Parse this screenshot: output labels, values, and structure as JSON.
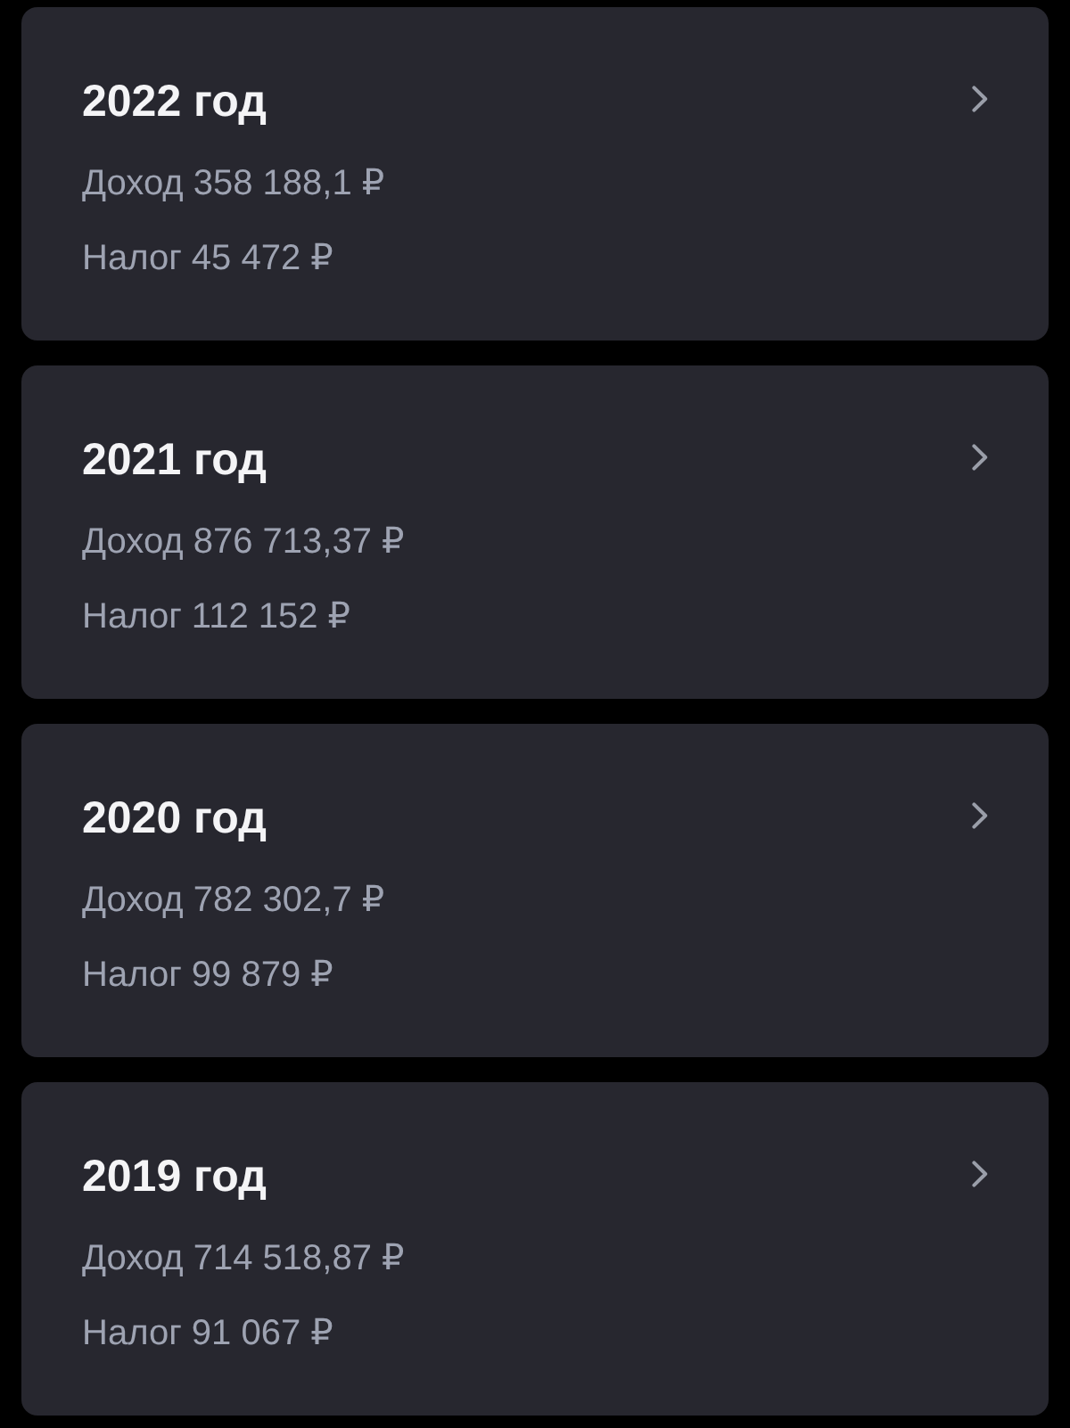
{
  "years": [
    {
      "title": "2022 год",
      "income": "Доход 358 188,1 ₽",
      "tax": "Налог 45 472 ₽"
    },
    {
      "title": "2021 год",
      "income": "Доход 876 713,37 ₽",
      "tax": "Налог 112 152 ₽"
    },
    {
      "title": "2020 год",
      "income": "Доход 782 302,7 ₽",
      "tax": "Налог 99 879 ₽"
    },
    {
      "title": "2019 год",
      "income": "Доход 714 518,87 ₽",
      "tax": "Налог 91 067 ₽"
    }
  ]
}
